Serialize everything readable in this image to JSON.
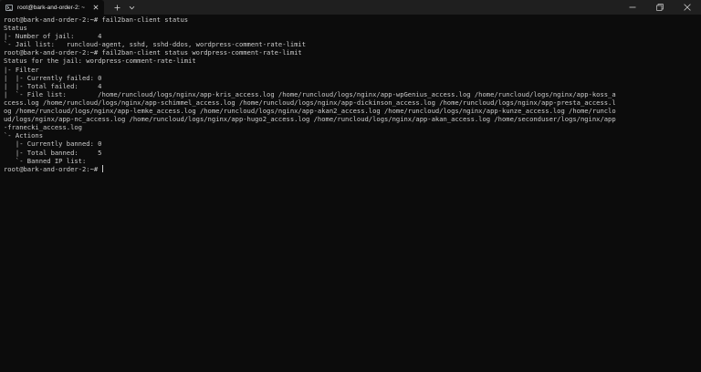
{
  "window": {
    "tab_title": "root@bark-and-order-2: ~"
  },
  "icons": {
    "tab": "terminal-icon",
    "close": "close-icon",
    "new_tab": "plus-icon",
    "dropdown": "chevron-down-icon",
    "minimize": "minimize-icon",
    "maximize": "restore-icon",
    "close_window": "close-window-icon"
  },
  "colors": {
    "background": "#0c0c0c",
    "text": "#cccccc",
    "titlebar": "#1f1f1f"
  },
  "terminal": {
    "lines": [
      "root@bark-and-order-2:~# fail2ban-client status",
      "Status",
      "|- Number of jail:      4",
      "`- Jail list:   runcloud-agent, sshd, sshd-ddos, wordpress-comment-rate-limit",
      "root@bark-and-order-2:~# fail2ban-client status wordpress-comment-rate-limit",
      "Status for the jail: wordpress-comment-rate-limit",
      "|- Filter",
      "|  |- Currently failed: 0",
      "|  |- Total failed:     4",
      "|  `- File list:        /home/runcloud/logs/nginx/app-kris_access.log /home/runcloud/logs/nginx/app-wpGenius_access.log /home/runcloud/logs/nginx/app-koss_a",
      "ccess.log /home/runcloud/logs/nginx/app-schimmel_access.log /home/runcloud/logs/nginx/app-dickinson_access.log /home/runcloud/logs/nginx/app-presta_access.l",
      "og /home/runcloud/logs/nginx/app-lemke_access.log /home/runcloud/logs/nginx/app-akan2_access.log /home/runcloud/logs/nginx/app-kunze_access.log /home/runclo",
      "ud/logs/nginx/app-nc_access.log /home/runcloud/logs/nginx/app-hugo2_access.log /home/runcloud/logs/nginx/app-akan_access.log /home/seconduser/logs/nginx/app",
      "-franecki_access.log",
      "`- Actions",
      "   |- Currently banned: 0",
      "   |- Total banned:     5",
      "   `- Banned IP list:"
    ],
    "prompt": "root@bark-and-order-2:~# "
  }
}
